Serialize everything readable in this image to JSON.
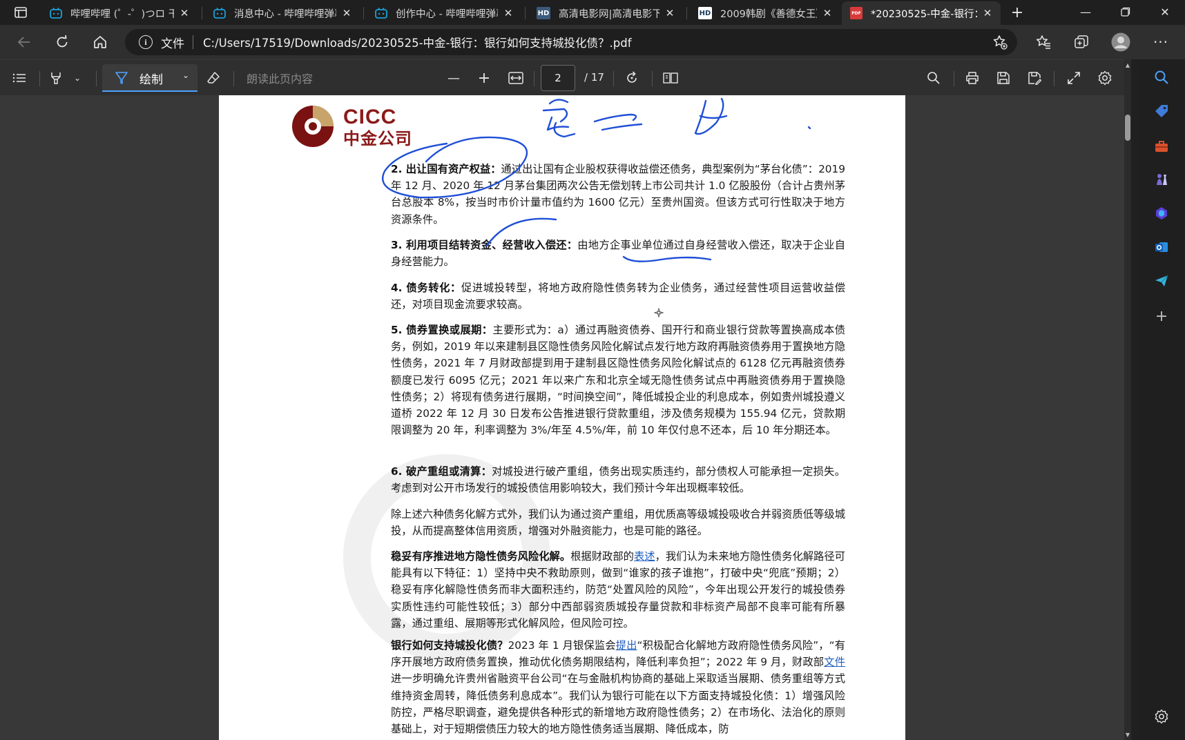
{
  "tabs": [
    {
      "title": "哔哩哔哩 (゜-゜)つロ 干",
      "favicon": "bilibili-icon",
      "active": false
    },
    {
      "title": "消息中心 - 哔哩哔哩弹幕",
      "favicon": "bilibili-icon",
      "active": false
    },
    {
      "title": "创作中心 - 哔哩哔哩弹幕",
      "favicon": "bilibili-icon",
      "active": false
    },
    {
      "title": "高清电影网|高清电影下载",
      "favicon": "hd-icon",
      "favicon_text": "HD",
      "active": false
    },
    {
      "title": "2009韩剧《善德女王》",
      "favicon": "hd-icon",
      "favicon_text": "HD",
      "active": false
    },
    {
      "title": "*20230525-中金-银行：",
      "favicon": "pdf-icon",
      "favicon_text": "PDF",
      "active": true
    }
  ],
  "address": {
    "info_label": "文件",
    "url": "C:/Users/17519/Downloads/20230525-中金-银行：银行如何支持城投化债？.pdf"
  },
  "pdf_toolbar": {
    "draw_label": "绘制",
    "read_aloud": "朗读此页内容",
    "page_current": "2",
    "page_total": "/ 17"
  },
  "document": {
    "logo_en": "CICC",
    "logo_cn": "中金公司",
    "p2_head": "2. 出让国有资产权益：",
    "p2_body": "通过出让国有企业股权获得收益偿还债务，典型案例为“茅台化债”：2019 年 12 月、2020 年 12 月茅台集团两次公告无偿划转上市公司共计 1.0 亿股股份（合计占贵州茅台总股本 8%，按当时市价计量市值约为 1600 亿元）至贵州国资。但该方式可行性取决于地方资源条件。",
    "p3_head": "3. 利用项目结转资金、经营收入偿还：",
    "p3_body": "由地方企事业单位通过自身经营收入偿还，取决于企业自身经营能力。",
    "p4_head": "4. 债务转化：",
    "p4_body": "促进城投转型，将地方政府隐性债务转为企业债务，通过经营性项目运营收益偿还，对项目现金流要求较高。",
    "p5_head": "5. 债券置换或展期：",
    "p5_body": "主要形式为：a）通过再融资债券、国开行和商业银行贷款等置换高成本债务，例如，2019 年以来建制县区隐性债务风险化解试点发行地方政府再融资债券用于置换地方隐性债务，2021 年 7 月财政部提到用于建制县区隐性债务风险化解试点的 6128 亿元再融资债券额度已发行 6095 亿元；2021 年以来广东和北京全域无隐性债务试点中再融资债券用于置换隐性债务；2）将现有债务进行展期，“时间换空间”，降低城投企业的利息成本，例如贵州城投遵义道桥 2022 年 12 月 30 日发布公告推进银行贷款重组，涉及债务规模为 155.94 亿元，贷款期限调整为 20 年，利率调整为 3%/年至 4.5%/年，前 10 年仅付息不还本，后 10 年分期还本。",
    "p6_head": "6. 破产重组或清算：",
    "p6_body": "对城投进行破产重组，债务出现实质违约，部分债权人可能承担一定损失。考虑到对公开市场发行的城投债信用影响较大，我们预计今年出现概率较低。",
    "p7_body": "除上述六种债务化解方式外，我们认为通过资产重组，用优质高等级城投吸收合并弱资质低等级城投，从而提高整体信用资质，增强对外融资能力，也是可能的路径。",
    "p8_head": "稳妥有序推进地方隐性债务风险化解。",
    "p8_pre": "根据财政部的",
    "p8_link": "表述",
    "p8_post": "，我们认为未来地方隐性债务化解路径可能具有以下特征：1）坚持中央不救助原则，做到“谁家的孩子谁抱”，打破中央“兜底”预期；2）稳妥有序化解隐性债务而非大面积违约，防范“处置风险的风险”，今年出现公开发行的城投债券实质性违约可能性较低；3）部分中西部弱资质城投存量贷款和非标资产局部不良率可能有所暴露，通过重组、展期等形式化解风险，但风险可控。",
    "p9_head": "银行如何支持城投化债？",
    "p9_pre": "2023 年 1 月银保监会",
    "p9_link1": "提出",
    "p9_mid": "“积极配合化解地方政府隐性债务风险”，“有序开展地方政府债务置换，推动优化债务期限结构，降低利率负担”；2022 年 9 月，财政部",
    "p9_link2": "文件",
    "p9_post": "进一步明确允许贵州省融资平台公司“在与金融机构协商的基础上采取适当展期、债务重组等方式维持资金周转，降低债务利息成本”。我们认为银行可能在以下方面支持城投化债：1）增强风险防控，严格尽职调查，避免提供各种形式的新增地方政府隐性债务；2）在市场化、法治化的原则基础上，对于短期偿债压力较大的地方隐性债务适当展期、降低成本，防"
  },
  "colors": {
    "ink": "#1f4fd6",
    "accent": "#4da3ff",
    "logo": "#8b1a1a"
  }
}
